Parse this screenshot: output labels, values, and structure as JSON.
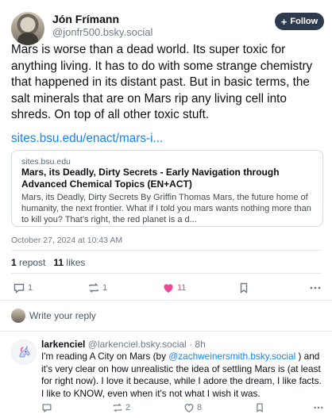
{
  "post": {
    "author_name": "Jón Frímann",
    "author_handle": "@jonfr500.bsky.social",
    "follow_label": "Follow",
    "text": "Mars is worse than a dead world. Its super toxic for anything living. It has to do with some strange chemistry that happened in its distant past. But in basic terms, the salt minerals that are on Mars rip any living cell into shreds. On top of all other toxic stuft.",
    "link_text": "sites.bsu.edu/enact/mars-i...",
    "embed": {
      "domain": "sites.bsu.edu",
      "title": "Mars, its Deadly, Dirty Secrets - Early Navigation through Advanced Chemical Topics (EN+ACT)",
      "description": "Mars, its Deadly, Dirty Secrets By Griffin Thomas Mars, the future home of humanity, the next frontier. What if I told you mars wants nothing more than to kill you? That's right, the red planet is a d..."
    },
    "timestamp": "October 27, 2024 at 10:43 AM",
    "reposts_count": "1",
    "reposts_label": "repost",
    "likes_count": "11",
    "likes_label": "likes",
    "actions": {
      "reply_count": "1",
      "repost_count": "1",
      "like_count": "11",
      "more_icon": "ellipsis-icon"
    }
  },
  "reply_box": {
    "placeholder": "Write your reply"
  },
  "reply": {
    "author_name": "larkenciel",
    "author_handle": "@larkenciel.bsky.social",
    "time": "· 8h",
    "text_before": "I'm reading A City on Mars (by ",
    "mention": "@zachweinersmith.bsky.social",
    "text_after": " ) and it's very clear on how unrealistic the idea of settling Mars is (at least for right now). I love it because, while I adore the dream, I like facts. I like to KNOW, even when it's not what I wish it was.",
    "actions": {
      "reply_count": "",
      "repost_count": "2",
      "like_count": "8"
    }
  },
  "colors": {
    "accent_link": "#1083fe",
    "like_active": "#ec4899",
    "follow_bg": "#2e3b4e"
  }
}
